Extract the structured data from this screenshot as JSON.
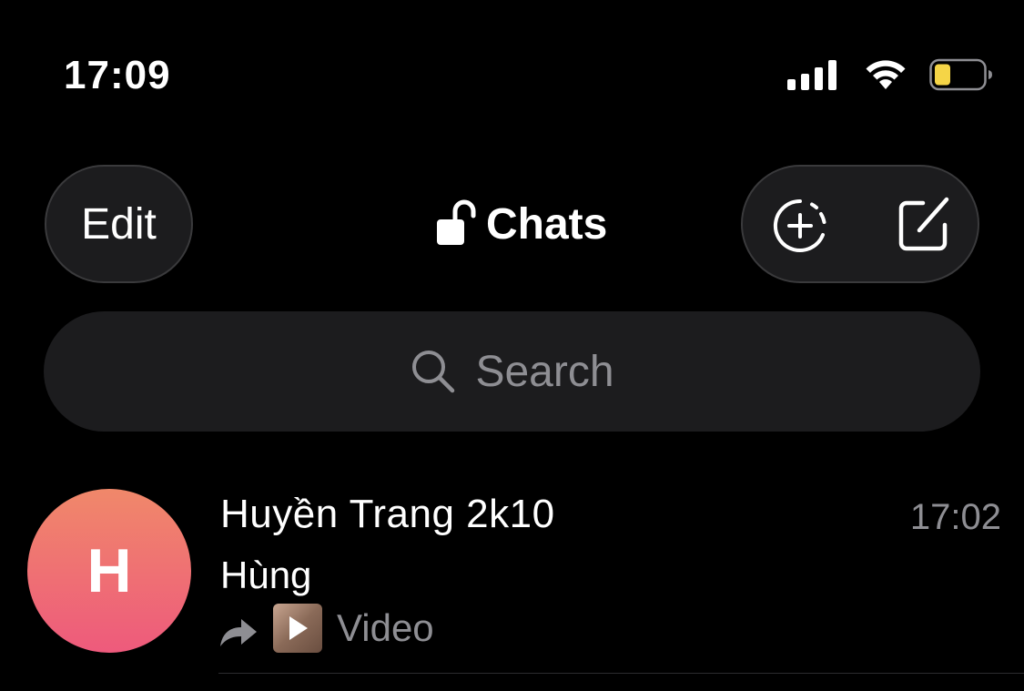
{
  "status_bar": {
    "time": "17:09",
    "icons": [
      "cellular-signal-icon",
      "wifi-icon",
      "battery-low-icon"
    ],
    "battery_color": "#f5d547"
  },
  "header": {
    "edit_label": "Edit",
    "title": "Chats",
    "title_icon": "unlock-icon",
    "actions": [
      "new-story-icon",
      "compose-icon"
    ]
  },
  "search": {
    "placeholder": "Search"
  },
  "chats": [
    {
      "avatar_letter": "H",
      "avatar_colors": [
        "#f0886a",
        "#ee5a7c"
      ],
      "name": "Huyền Trang 2k10",
      "time": "17:02",
      "sender": "Hùng",
      "preview_icon": "forward-icon",
      "preview_thumb": "video-thumbnail",
      "preview_text": "Video"
    }
  ],
  "colors": {
    "background": "#000000",
    "surface": "#1c1c1e",
    "secondary_text": "#8e8e93",
    "primary_text": "#ffffff"
  }
}
